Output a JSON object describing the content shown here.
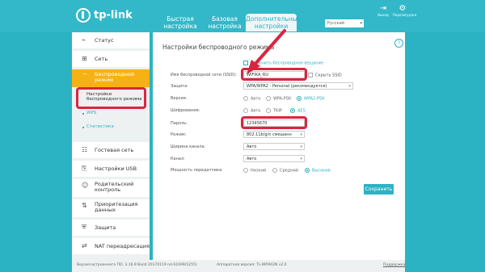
{
  "header": {
    "logo": "tp-link",
    "tabs": [
      {
        "label": "Быстрая настройка",
        "active": false
      },
      {
        "label": "Базовая настройка",
        "active": false
      },
      {
        "label": "Дополнительные настройки",
        "active": true
      }
    ],
    "language": "Русский",
    "icons": [
      {
        "label": "Выход",
        "icon": "logout-icon"
      },
      {
        "label": "Перезагрузка",
        "icon": "reboot-icon"
      }
    ]
  },
  "sidebar": {
    "items": [
      {
        "label": "Статус",
        "icon": "status-icon"
      },
      {
        "label": "Сеть",
        "icon": "network-icon"
      },
      {
        "label": "Беспроводной режим",
        "icon": "wireless-icon",
        "active": true
      },
      {
        "label": "Гостевая сеть",
        "icon": "guest-icon"
      },
      {
        "label": "Настройки USB",
        "icon": "usb-icon"
      },
      {
        "label": "Родительский контроль",
        "icon": "parental-icon"
      },
      {
        "label": "Приоритезация данных",
        "icon": "qos-icon"
      },
      {
        "label": "Защита",
        "icon": "shield-icon"
      },
      {
        "label": "NAT переадресация",
        "icon": "nat-icon"
      }
    ],
    "subitems": [
      {
        "label": "Настройки беспроводного режима",
        "selected": true
      },
      {
        "label": "WPS",
        "selected": false
      },
      {
        "label": "Статистика",
        "selected": false
      }
    ]
  },
  "main": {
    "title": "Настройки беспроводного режима",
    "enable_wireless": "Включить беспроводное вещание",
    "ssid_label": "Имя беспроводной сети (SSID):",
    "ssid_value": "WIFIKA_RU",
    "hide_ssid": "Скрыть SSID",
    "security_label": "Защита:",
    "security_value": "WPA/WPA2 - Personal (рекомендуется)",
    "version_label": "Версия:",
    "version_options": [
      "Авто",
      "WPA-PSK",
      "WPA2-PSK"
    ],
    "version_selected": "WPA2-PSK",
    "encryption_label": "Шифрование:",
    "encryption_options": [
      "Авто",
      "TKIP",
      "AES"
    ],
    "encryption_selected": "AES",
    "password_label": "Пароль:",
    "password_value": "12345670",
    "mode_label": "Режим:",
    "mode_value": "802.11b/g/n смешанн",
    "channel_width_label": "Ширина канала:",
    "channel_width_value": "Авто",
    "channel_label": "Канал:",
    "channel_value": "Авто",
    "power_label": "Мощность передатчика:",
    "power_options": [
      "Низкий",
      "Средний",
      "Высокий"
    ],
    "power_selected": "Высокий",
    "save_label": "Сохранить"
  },
  "footer": {
    "firmware": "Версия встроенного ПО: 3.16.9 Build 20170119 rel.61699(5255)",
    "hardware": "Аппаратная версия: TL-WR942N v2.0",
    "support": "Поддержка"
  },
  "colors": {
    "accent": "#2bb3c4",
    "active_menu": "#f6b214",
    "highlight": "#d9263f"
  }
}
